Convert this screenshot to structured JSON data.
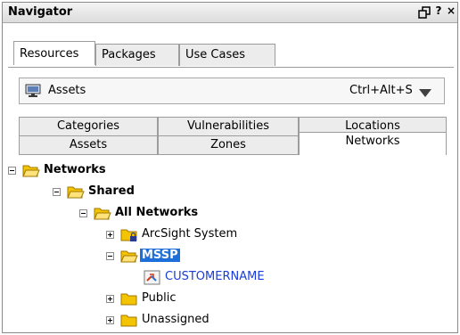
{
  "window": {
    "title": "Navigator",
    "controls": {
      "restore": "restore-icon",
      "help": "?",
      "close": "×"
    }
  },
  "toptabs": [
    {
      "label": "Resources",
      "active": true
    },
    {
      "label": "Packages",
      "active": false
    },
    {
      "label": "Use Cases",
      "active": false
    }
  ],
  "combo": {
    "icon": "monitor-icon",
    "label": "Assets",
    "shortcut": "Ctrl+Alt+S"
  },
  "subtabs": {
    "row_back": [
      {
        "label": "Categories"
      },
      {
        "label": "Vulnerabilities"
      },
      {
        "label": "Locations"
      }
    ],
    "row_front": [
      {
        "label": "Assets"
      },
      {
        "label": "Zones"
      },
      {
        "label": "Networks",
        "active": true
      }
    ]
  },
  "tree": [
    {
      "label": "Networks",
      "expanded": true,
      "icon": "open-folder-icon"
    },
    {
      "label": "Shared",
      "expanded": true,
      "icon": "open-folder-icon"
    },
    {
      "label": "All Networks",
      "expanded": true,
      "icon": "open-folder-icon"
    },
    {
      "label": "ArcSight System",
      "expanded": false,
      "icon": "locked-folder-icon"
    },
    {
      "label": "MSSP",
      "expanded": true,
      "icon": "open-folder-icon",
      "selected": true
    },
    {
      "label": "CUSTOMERNAME",
      "icon": "network-link-icon"
    },
    {
      "label": "Public",
      "expanded": false,
      "icon": "folder-icon"
    },
    {
      "label": "Unassigned",
      "expanded": false,
      "icon": "folder-icon"
    }
  ],
  "colors": {
    "selection": "#1e6fd9",
    "folder": "#f5c400",
    "link_text": "#1a3cd8"
  }
}
